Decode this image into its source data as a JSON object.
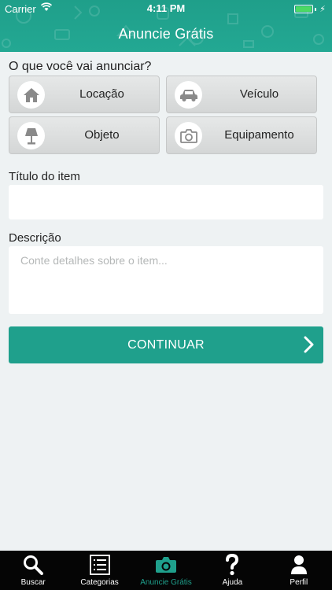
{
  "status_bar": {
    "carrier": "Carrier",
    "time": "4:11 PM"
  },
  "header": {
    "title": "Anuncie Grátis"
  },
  "form": {
    "question": "O que você vai anunciar?",
    "categories": [
      {
        "label": "Locação",
        "icon": "house-icon"
      },
      {
        "label": "Veículo",
        "icon": "car-icon"
      },
      {
        "label": "Objeto",
        "icon": "lamp-icon"
      },
      {
        "label": "Equipamento",
        "icon": "camera-icon"
      }
    ],
    "title_label": "Título do item",
    "title_value": "",
    "description_label": "Descrição",
    "description_placeholder": "Conte detalhes sobre o item...",
    "continue_label": "CONTINUAR"
  },
  "tabbar": {
    "items": [
      {
        "label": "Buscar",
        "icon": "search-icon",
        "active": false
      },
      {
        "label": "Categorias",
        "icon": "list-icon",
        "active": false
      },
      {
        "label": "Anuncie Grátis",
        "icon": "camera-icon",
        "active": true
      },
      {
        "label": "Ajuda",
        "icon": "question-icon",
        "active": false
      },
      {
        "label": "Perfil",
        "icon": "person-icon",
        "active": false
      }
    ]
  },
  "colors": {
    "accent": "#1fa08c",
    "tabbar_bg": "#050505",
    "page_bg": "#eef2f3"
  }
}
